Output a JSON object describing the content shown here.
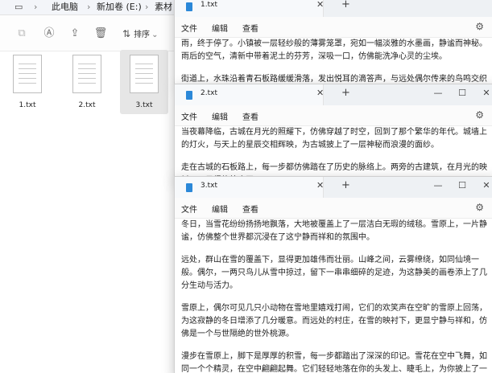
{
  "explorer": {
    "breadcrumbs": [
      "此电脑",
      "新加卷 (E:)",
      "素材"
    ],
    "sort_label": "排序",
    "files": [
      {
        "name": "1.txt",
        "selected": false
      },
      {
        "name": "2.txt",
        "selected": false
      },
      {
        "name": "3.txt",
        "selected": true
      }
    ],
    "toolbar_icons": [
      "copy-icon",
      "rename-icon",
      "share-icon",
      "delete-icon",
      "sort-icon"
    ]
  },
  "windows": [
    {
      "tab_title": "1.txt",
      "menus": [
        "文件",
        "编辑",
        "查看"
      ],
      "paragraphs": [
        "雨，终于停了。小镇被一层轻纱般的薄雾笼罩，宛如一幅淡雅的水墨画，静谧而神秘。雨后的空气，清新中带着泥土的芬芳，深吸一口，仿佛能洗净心灵的尘埃。",
        "街道上，水珠沿着青石板路缓缓滑落，发出悦耳的滴答声，与远处偶尔传来的鸟鸣交织成一首自然的乐章。屋檐下，水珠连成线，如同晶莹的珠帘，为小镇增添了几分诗意。"
      ]
    },
    {
      "tab_title": "2.txt",
      "menus": [
        "文件",
        "编辑",
        "查看"
      ],
      "paragraphs": [
        "当夜幕降临，古城在月光的照耀下，仿佛穿越了时空，回到了那个繁华的年代。城墙上的灯火，与天上的星辰交相辉映，为古城披上了一层神秘而浪漫的面纱。",
        "走在古城的石板路上，每一步都仿佛踏在了历史的脉络上。两旁的古建筑，在月光的映衬下，显得格外庄严。"
      ]
    },
    {
      "tab_title": "3.txt",
      "menus": [
        "文件",
        "编辑",
        "查看"
      ],
      "paragraphs": [
        "冬日，当雪花纷纷扬扬地飘落，大地被覆盖上了一层洁白无瑕的绒毯。雪原上，一片静谧，仿佛整个世界都沉浸在了这宁静而祥和的氛围中。",
        "远处，群山在雪的覆盖下，显得更加雄伟而壮丽。山峰之间，云雾缭绕，如同仙境一般。偶尔，一两只鸟儿从雪中掠过，留下一串串细碎的足迹，为这静美的画卷添上了几分生动与活力。",
        "雪原上，偶尔可见几只小动物在雪地里嬉戏打闹，它们的欢笑声在空旷的雪原上回荡，为这寂静的冬日增添了几分暖意。而远处的村庄，在雪的映衬下，更显宁静与祥和，仿佛是一个与世隔绝的世外桃源。",
        "漫步在雪原上，脚下是厚厚的积雪，每一步都踏出了深深的印记。雪花在空中飞舞，如同一个个精灵，在空中翩翩起舞。它们轻轻地落在你的头发上、睫毛上，为你披上了一层洁白的纱衣。"
      ]
    }
  ],
  "colors": {
    "accent": "#2b88d8",
    "selection": "#e6e6e6",
    "titlebar": "#eef1f4"
  }
}
